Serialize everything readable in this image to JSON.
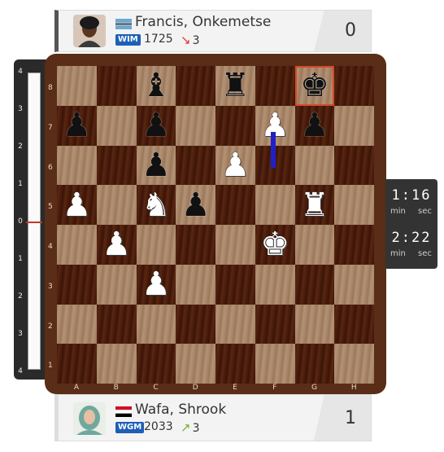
{
  "players": {
    "top": {
      "name": "Francis, Onkemetse",
      "title": "WIM",
      "rating": "1725",
      "delta": "3",
      "delta_dir": "down",
      "score": "0",
      "flag": "botswana-flag"
    },
    "bottom": {
      "name": "Wafa, Shrook",
      "title": "WGM",
      "rating": "2033",
      "delta": "3",
      "delta_dir": "up",
      "score": "1",
      "flag": "egypt-flag"
    }
  },
  "eval_bar": {
    "labels": [
      "4",
      "3",
      "2",
      "1",
      "0",
      "1",
      "2",
      "3",
      "4"
    ],
    "value": 0
  },
  "board": {
    "files": [
      "A",
      "B",
      "C",
      "D",
      "E",
      "F",
      "G",
      "H"
    ],
    "ranks": [
      "8",
      "7",
      "6",
      "5",
      "4",
      "3",
      "2",
      "1"
    ],
    "highlight": "g8",
    "pieces": [
      {
        "sq": "c8",
        "color": "black",
        "type": "bishop"
      },
      {
        "sq": "e8",
        "color": "black",
        "type": "rook"
      },
      {
        "sq": "g8",
        "color": "black",
        "type": "king"
      },
      {
        "sq": "a7",
        "color": "black",
        "type": "pawn"
      },
      {
        "sq": "c7",
        "color": "black",
        "type": "pawn"
      },
      {
        "sq": "f7",
        "color": "white",
        "type": "pawn"
      },
      {
        "sq": "g7",
        "color": "black",
        "type": "pawn"
      },
      {
        "sq": "c6",
        "color": "black",
        "type": "pawn"
      },
      {
        "sq": "e6",
        "color": "white",
        "type": "pawn"
      },
      {
        "sq": "a5",
        "color": "white",
        "type": "pawn"
      },
      {
        "sq": "c5",
        "color": "white",
        "type": "knight"
      },
      {
        "sq": "d5",
        "color": "black",
        "type": "pawn"
      },
      {
        "sq": "g5",
        "color": "white",
        "type": "rook"
      },
      {
        "sq": "b4",
        "color": "white",
        "type": "pawn"
      },
      {
        "sq": "f4",
        "color": "white",
        "type": "king"
      },
      {
        "sq": "c3",
        "color": "white",
        "type": "pawn"
      }
    ]
  },
  "clock": {
    "top": {
      "time": "1:16",
      "min_label": "min",
      "sec_label": "sec"
    },
    "bottom": {
      "time": "2:22",
      "min_label": "min",
      "sec_label": "sec"
    }
  }
}
